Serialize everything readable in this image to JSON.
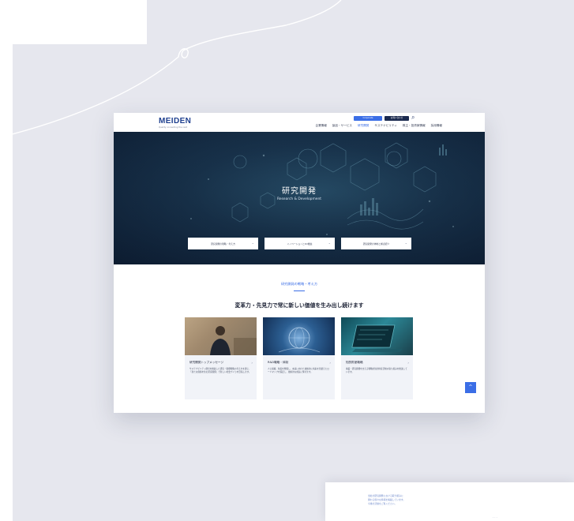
{
  "site": {
    "logo": "MEIDEN",
    "tagline": "Quality connecting the next",
    "header_buttons": [
      "Corporate",
      "お問い合わせ"
    ],
    "nav": [
      "企業情報",
      "製品・サービス",
      "研究開発",
      "サステナビリティ",
      "株主・投資家情報",
      "採用情報"
    ],
    "active_nav": "研究開発"
  },
  "hero": {
    "title": "研究開発",
    "subtitle": "Research & Development",
    "tabs": [
      "研究開発の戦略・考え方",
      "イノベーションとDX推進",
      "研究開発の体制と拠点紹介"
    ]
  },
  "section": {
    "label": "研究開発の戦略・考え方",
    "heading": "変革力・先見力で常に新しい価値を生み出し続けます",
    "cards": [
      {
        "title": "研究開発トップメッセージ",
        "desc": "サステナビリティ経営を推進した研究・開発戦略の考え方を通じ、「新たな価値を生む研究開発」で新しい社会づくりを目指します。"
      },
      {
        "title": "R&D戦略・体制",
        "desc": "人と組織、制度を整備し、未来に向けた技術的に将来を見据えたロードマップを策定し、技術的な成長に繋げます。"
      },
      {
        "title": "知的財産戦略",
        "desc": "事業・研究開発を支える戦略的知的財産活動の取り組みを推進しています。"
      }
    ]
  },
  "scroll_top": "^",
  "preview2": {
    "lines": [
      "当社の研究開発における取り組みに",
      "関わる様々な情報を掲載しています。",
      "今後の活動をご覧ください。"
    ]
  }
}
